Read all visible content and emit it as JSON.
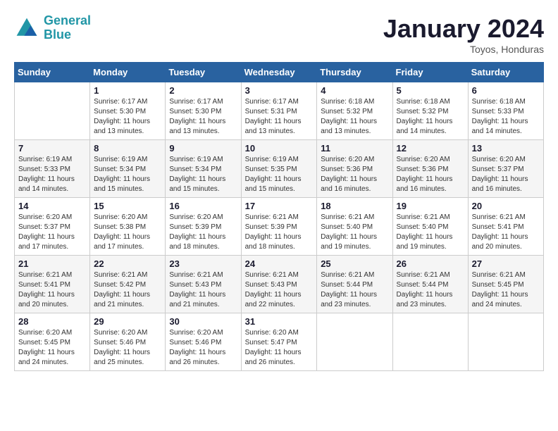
{
  "header": {
    "logo_line1": "General",
    "logo_line2": "Blue",
    "month": "January 2024",
    "location": "Toyos, Honduras"
  },
  "days_of_week": [
    "Sunday",
    "Monday",
    "Tuesday",
    "Wednesday",
    "Thursday",
    "Friday",
    "Saturday"
  ],
  "weeks": [
    [
      {
        "day": "",
        "info": ""
      },
      {
        "day": "1",
        "info": "Sunrise: 6:17 AM\nSunset: 5:30 PM\nDaylight: 11 hours\nand 13 minutes."
      },
      {
        "day": "2",
        "info": "Sunrise: 6:17 AM\nSunset: 5:30 PM\nDaylight: 11 hours\nand 13 minutes."
      },
      {
        "day": "3",
        "info": "Sunrise: 6:17 AM\nSunset: 5:31 PM\nDaylight: 11 hours\nand 13 minutes."
      },
      {
        "day": "4",
        "info": "Sunrise: 6:18 AM\nSunset: 5:32 PM\nDaylight: 11 hours\nand 13 minutes."
      },
      {
        "day": "5",
        "info": "Sunrise: 6:18 AM\nSunset: 5:32 PM\nDaylight: 11 hours\nand 14 minutes."
      },
      {
        "day": "6",
        "info": "Sunrise: 6:18 AM\nSunset: 5:33 PM\nDaylight: 11 hours\nand 14 minutes."
      }
    ],
    [
      {
        "day": "7",
        "info": "Sunrise: 6:19 AM\nSunset: 5:33 PM\nDaylight: 11 hours\nand 14 minutes."
      },
      {
        "day": "8",
        "info": "Sunrise: 6:19 AM\nSunset: 5:34 PM\nDaylight: 11 hours\nand 15 minutes."
      },
      {
        "day": "9",
        "info": "Sunrise: 6:19 AM\nSunset: 5:34 PM\nDaylight: 11 hours\nand 15 minutes."
      },
      {
        "day": "10",
        "info": "Sunrise: 6:19 AM\nSunset: 5:35 PM\nDaylight: 11 hours\nand 15 minutes."
      },
      {
        "day": "11",
        "info": "Sunrise: 6:20 AM\nSunset: 5:36 PM\nDaylight: 11 hours\nand 16 minutes."
      },
      {
        "day": "12",
        "info": "Sunrise: 6:20 AM\nSunset: 5:36 PM\nDaylight: 11 hours\nand 16 minutes."
      },
      {
        "day": "13",
        "info": "Sunrise: 6:20 AM\nSunset: 5:37 PM\nDaylight: 11 hours\nand 16 minutes."
      }
    ],
    [
      {
        "day": "14",
        "info": "Sunrise: 6:20 AM\nSunset: 5:37 PM\nDaylight: 11 hours\nand 17 minutes."
      },
      {
        "day": "15",
        "info": "Sunrise: 6:20 AM\nSunset: 5:38 PM\nDaylight: 11 hours\nand 17 minutes."
      },
      {
        "day": "16",
        "info": "Sunrise: 6:20 AM\nSunset: 5:39 PM\nDaylight: 11 hours\nand 18 minutes."
      },
      {
        "day": "17",
        "info": "Sunrise: 6:21 AM\nSunset: 5:39 PM\nDaylight: 11 hours\nand 18 minutes."
      },
      {
        "day": "18",
        "info": "Sunrise: 6:21 AM\nSunset: 5:40 PM\nDaylight: 11 hours\nand 19 minutes."
      },
      {
        "day": "19",
        "info": "Sunrise: 6:21 AM\nSunset: 5:40 PM\nDaylight: 11 hours\nand 19 minutes."
      },
      {
        "day": "20",
        "info": "Sunrise: 6:21 AM\nSunset: 5:41 PM\nDaylight: 11 hours\nand 20 minutes."
      }
    ],
    [
      {
        "day": "21",
        "info": "Sunrise: 6:21 AM\nSunset: 5:41 PM\nDaylight: 11 hours\nand 20 minutes."
      },
      {
        "day": "22",
        "info": "Sunrise: 6:21 AM\nSunset: 5:42 PM\nDaylight: 11 hours\nand 21 minutes."
      },
      {
        "day": "23",
        "info": "Sunrise: 6:21 AM\nSunset: 5:43 PM\nDaylight: 11 hours\nand 21 minutes."
      },
      {
        "day": "24",
        "info": "Sunrise: 6:21 AM\nSunset: 5:43 PM\nDaylight: 11 hours\nand 22 minutes."
      },
      {
        "day": "25",
        "info": "Sunrise: 6:21 AM\nSunset: 5:44 PM\nDaylight: 11 hours\nand 23 minutes."
      },
      {
        "day": "26",
        "info": "Sunrise: 6:21 AM\nSunset: 5:44 PM\nDaylight: 11 hours\nand 23 minutes."
      },
      {
        "day": "27",
        "info": "Sunrise: 6:21 AM\nSunset: 5:45 PM\nDaylight: 11 hours\nand 24 minutes."
      }
    ],
    [
      {
        "day": "28",
        "info": "Sunrise: 6:20 AM\nSunset: 5:45 PM\nDaylight: 11 hours\nand 24 minutes."
      },
      {
        "day": "29",
        "info": "Sunrise: 6:20 AM\nSunset: 5:46 PM\nDaylight: 11 hours\nand 25 minutes."
      },
      {
        "day": "30",
        "info": "Sunrise: 6:20 AM\nSunset: 5:46 PM\nDaylight: 11 hours\nand 26 minutes."
      },
      {
        "day": "31",
        "info": "Sunrise: 6:20 AM\nSunset: 5:47 PM\nDaylight: 11 hours\nand 26 minutes."
      },
      {
        "day": "",
        "info": ""
      },
      {
        "day": "",
        "info": ""
      },
      {
        "day": "",
        "info": ""
      }
    ]
  ]
}
